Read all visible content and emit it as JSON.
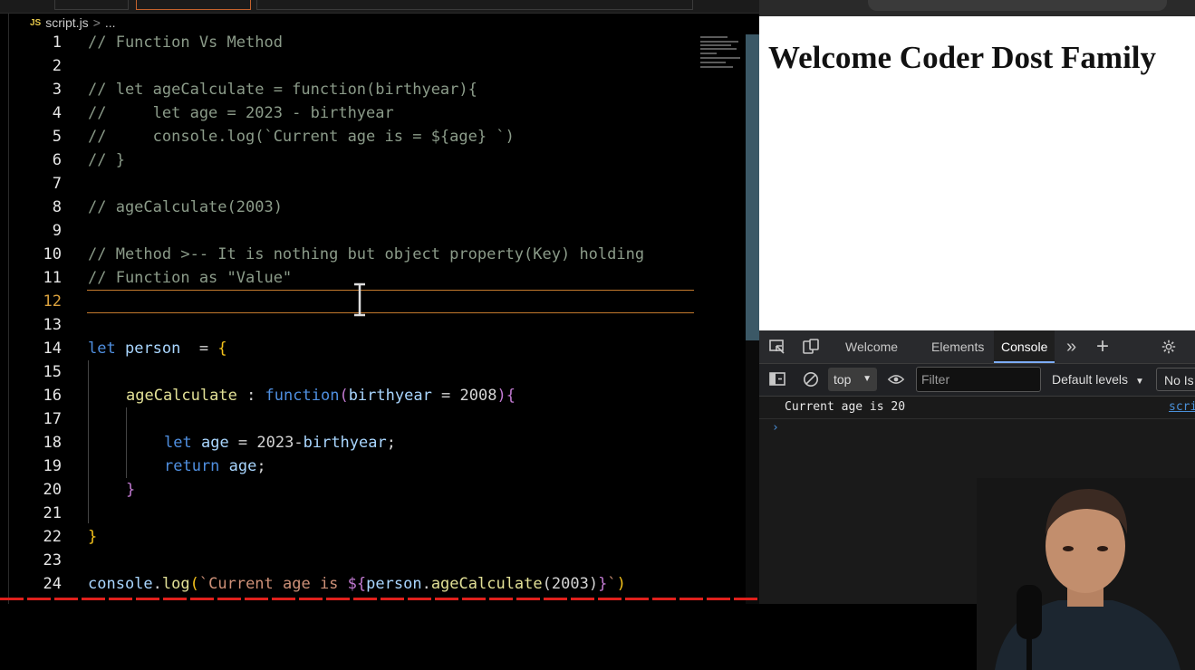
{
  "editor": {
    "breadcrumb": {
      "file_icon": "JS",
      "file_name": "script.js",
      "separator": ">",
      "trail": "..."
    },
    "active_line": 12,
    "lines": [
      {
        "n": "1"
      },
      {
        "n": "2"
      },
      {
        "n": "3"
      },
      {
        "n": "4"
      },
      {
        "n": "5"
      },
      {
        "n": "6"
      },
      {
        "n": "7"
      },
      {
        "n": "8"
      },
      {
        "n": "9"
      },
      {
        "n": "10"
      },
      {
        "n": "11"
      },
      {
        "n": "12"
      },
      {
        "n": "13"
      },
      {
        "n": "14"
      },
      {
        "n": "15"
      },
      {
        "n": "16"
      },
      {
        "n": "17"
      },
      {
        "n": "18"
      },
      {
        "n": "19"
      },
      {
        "n": "20"
      },
      {
        "n": "21"
      },
      {
        "n": "22"
      },
      {
        "n": "23"
      },
      {
        "n": "24"
      }
    ],
    "code": {
      "l1": "// Function Vs Method",
      "l3": "// let ageCalculate = function(birthyear){",
      "l4": "//     let age = 2023 - birthyear",
      "l5": "//     console.log(`Current age is = ${age} `)",
      "l6": "// }",
      "l8": "// ageCalculate(2003)",
      "l10": "// Method >-- It is nothing but object property(Key) holding",
      "l11": "// Function as \"Value\"",
      "l14": {
        "kw": "let",
        "var": "person",
        "op": "  = ",
        "brace": "{"
      },
      "l16": {
        "prop": "ageCalculate",
        "colon": " : ",
        "kw": "function",
        "paren": "(",
        "param": "birthyear",
        "eq": " = ",
        "num": "2008",
        "close": ")",
        "brace": "{"
      },
      "l18": {
        "kw": "let",
        "var": "age",
        "eq": " = ",
        "num": "2023",
        "minus": "-",
        "param": "birthyear",
        "semi": ";"
      },
      "l19": {
        "kw": "return",
        "var": "age",
        "semi": ";"
      },
      "l20": {
        "brace": "}"
      },
      "l22": {
        "brace": "}"
      },
      "l24": {
        "obj": "console",
        "dot": ".",
        "fn": "log",
        "paren": "(",
        "tick": "`",
        "text": "Current age is ",
        "ph_open": "${",
        "p1": "person",
        "dot2": ".",
        "p2": "ageCalculate",
        "p3": "(2003)",
        "ph_close": "}",
        "tick2": "`",
        "close": ")"
      }
    }
  },
  "browser": {
    "page_heading": "Welcome Coder Dost Family"
  },
  "devtools": {
    "tabs": [
      "Welcome",
      "Elements",
      "Console"
    ],
    "active_tab": "Console",
    "more_tabs": "»",
    "add_tab": "+",
    "context": "top",
    "filter_placeholder": "Filter",
    "levels": "Default levels",
    "issues": "No Is",
    "log": {
      "message": "Current age is 20",
      "source": "scri"
    },
    "prompt": "›"
  },
  "colors": {
    "accent_line": "#c47a2d",
    "link": "#4a90d9",
    "active_tab_underline": "#7cacf8"
  }
}
